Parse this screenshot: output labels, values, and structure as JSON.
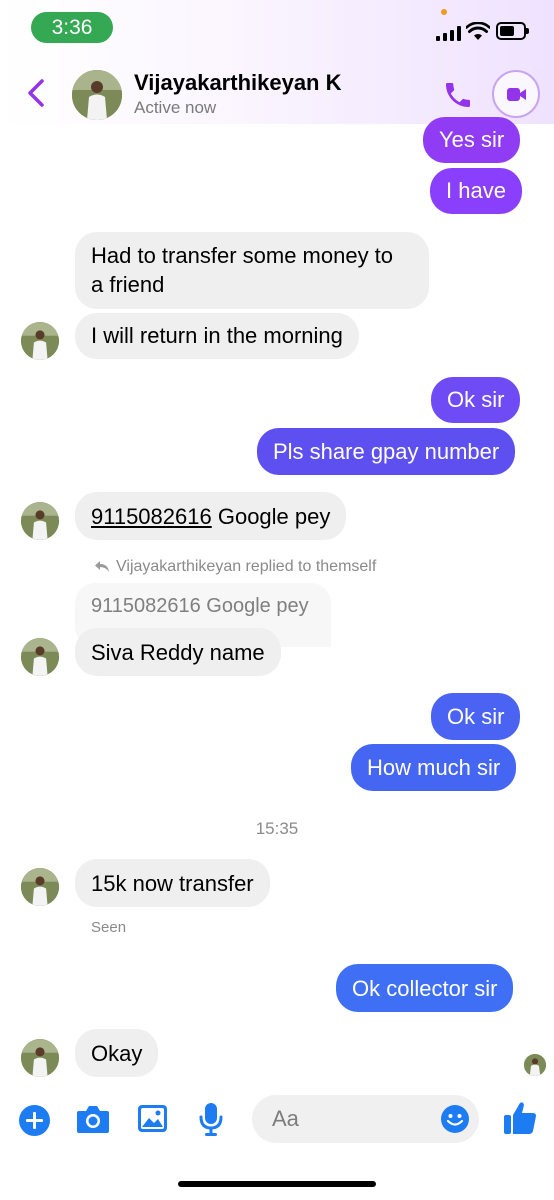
{
  "status_bar": {
    "time": "3:36"
  },
  "header": {
    "contact_name": "Vijayakarthikeyan K",
    "presence": "Active now"
  },
  "messages": {
    "m1": "Yes sir",
    "m2": "I have",
    "m3_line1": "Had to transfer some money to",
    "m3_line2": "a friend",
    "m4": "I will return in the morning",
    "m5": "Ok sir",
    "m6": "Pls share gpay number",
    "m7_number": "9115082616",
    "m7_rest": " Google pey",
    "reply_note": "Vijayakarthikeyan replied to themself",
    "quoted": "9115082616 Google pey",
    "m8": "Siva Reddy name",
    "m9": "Ok sir",
    "m10": "How much sir",
    "timestamp": "15:35",
    "m11": "15k now transfer",
    "seen": "Seen",
    "m12": "Ok collector sir",
    "m13": "Okay"
  },
  "composer": {
    "placeholder": "Aa"
  },
  "colors": {
    "accent_purple": "#9333ea",
    "bubble_purple": "#8a3ffc",
    "bubble_indigo": "#5e4ff0",
    "bubble_blue": "#3f6ff5",
    "toolbar_blue": "#1e7cf2",
    "incoming_bg": "#efefef"
  }
}
